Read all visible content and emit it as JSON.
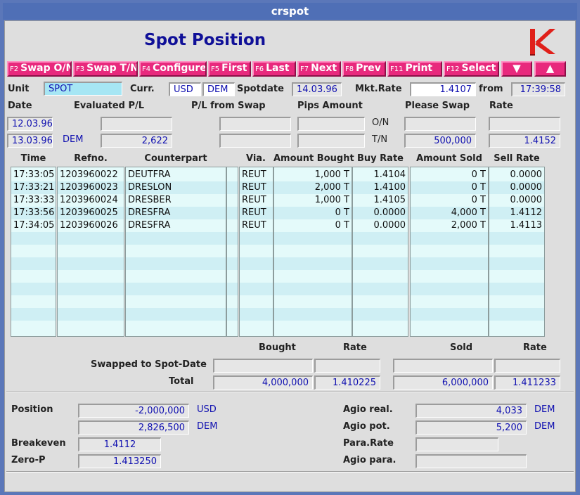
{
  "window": {
    "title": "crspot"
  },
  "page_title": "Spot Position",
  "colors": {
    "function_key": "#e8297d",
    "value_text": "#1010b0",
    "table_bg": "#e4fafa"
  },
  "fkeys": [
    {
      "key": "F2",
      "label": "Swap O/N"
    },
    {
      "key": "F3",
      "label": "Swap T/N"
    },
    {
      "key": "F4",
      "label": "Configure"
    },
    {
      "key": "F5",
      "label": "First"
    },
    {
      "key": "F6",
      "label": "Last"
    },
    {
      "key": "F7",
      "label": "Next"
    },
    {
      "key": "F8",
      "label": "Prev"
    },
    {
      "key": "F11",
      "label": "Print"
    },
    {
      "key": "F12",
      "label": "Select"
    }
  ],
  "scroll_down_glyph": "▼",
  "scroll_up_glyph": "▲",
  "header": {
    "unit_label": "Unit",
    "unit_value": "SPOT",
    "curr_label": "Curr.",
    "curr1": "USD",
    "curr2": "DEM",
    "spotdate_label": "Spotdate",
    "spotdate_value": "14.03.96",
    "mktrate_label": "Mkt.Rate",
    "mktrate_value": "1.4107",
    "from_label": "from",
    "from_value": "17:39:58"
  },
  "pl": {
    "date_label": "Date",
    "evaluated_label": "Evaluated P/L",
    "pl_swap_label": "P/L from Swap",
    "pips_label": "Pips Amount",
    "please_swap_label": "Please Swap",
    "rate_label": "Rate",
    "date1": "12.03.96",
    "date2": "13.03.96",
    "currency": "DEM",
    "evaluated_value": "2,622",
    "on_label": "O/N",
    "tn_label": "T/N",
    "tn_amount": "500,000",
    "tn_rate": "1.4152"
  },
  "table": {
    "columns": [
      "Time",
      "Refno.",
      "Counterpart",
      "Via.",
      "Amount Bought",
      "Buy Rate",
      "Amount Sold",
      "Sell Rate"
    ],
    "rows": [
      {
        "time": "17:33:05",
        "refno": "1203960022",
        "counterpart": "DEUTFRA",
        "via": "REUT",
        "bought": "1,000 T",
        "buy_rate": "1.4104",
        "sold": "0 T",
        "sell_rate": "0.0000"
      },
      {
        "time": "17:33:21",
        "refno": "1203960023",
        "counterpart": "DRESLON",
        "via": "REUT",
        "bought": "2,000 T",
        "buy_rate": "1.4100",
        "sold": "0 T",
        "sell_rate": "0.0000"
      },
      {
        "time": "17:33:33",
        "refno": "1203960024",
        "counterpart": "DRESBER",
        "via": "REUT",
        "bought": "1,000 T",
        "buy_rate": "1.4105",
        "sold": "0 T",
        "sell_rate": "0.0000"
      },
      {
        "time": "17:33:56",
        "refno": "1203960025",
        "counterpart": "DRESFRA",
        "via": "REUT",
        "bought": "0 T",
        "buy_rate": "0.0000",
        "sold": "4,000 T",
        "sell_rate": "1.4112"
      },
      {
        "time": "17:34:05",
        "refno": "1203960026",
        "counterpart": "DRESFRA",
        "via": "REUT",
        "bought": "0 T",
        "buy_rate": "0.0000",
        "sold": "2,000 T",
        "sell_rate": "1.4113"
      }
    ]
  },
  "totals": {
    "bought_label": "Bought",
    "rate_label": "Rate",
    "sold_label": "Sold",
    "swapped_label": "Swapped to Spot-Date",
    "total_label": "Total",
    "total_bought": "4,000,000",
    "total_buy_rate": "1.410225",
    "total_sold": "6,000,000",
    "total_sell_rate": "1.411233"
  },
  "position": {
    "position_label": "Position",
    "position_usd": "-2,000,000",
    "usd": "USD",
    "position_dem": "2,826,500",
    "dem": "DEM",
    "breakeven_label": "Breakeven",
    "breakeven_value": "1.4112",
    "zerop_label": "Zero-P",
    "zerop_value": "1.413250",
    "agio_real_label": "Agio real.",
    "agio_real_value": "4,033",
    "agio_real_cur": "DEM",
    "agio_pot_label": "Agio pot.",
    "agio_pot_value": "5,200",
    "agio_pot_cur": "DEM",
    "para_rate_label": "Para.Rate",
    "agio_para_label": "Agio para."
  }
}
